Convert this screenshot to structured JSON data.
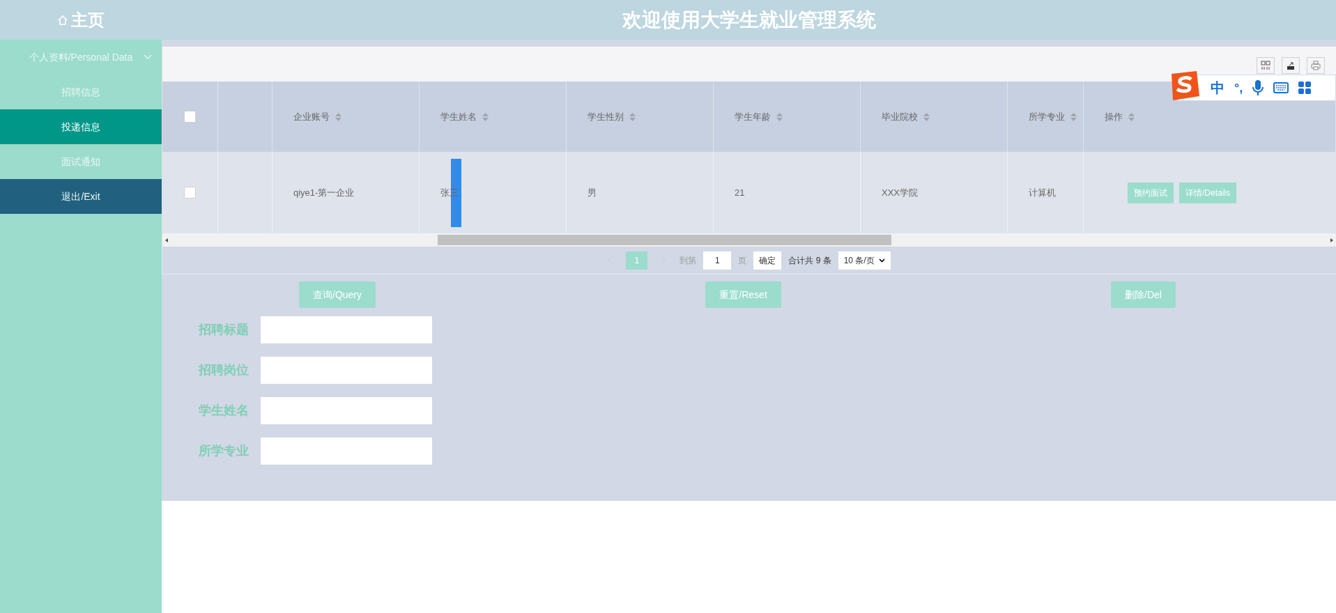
{
  "header": {
    "home": "主页",
    "title": "欢迎使用大学生就业管理系统"
  },
  "sidebar": {
    "items": [
      {
        "label": "个人资料/Personal Data",
        "kind": "group",
        "expanded": true,
        "selected": false
      },
      {
        "label": "招聘信息",
        "kind": "link",
        "selected": false
      },
      {
        "label": "投递信息",
        "kind": "link",
        "selected": true
      },
      {
        "label": "面试通知",
        "kind": "link",
        "selected": false
      },
      {
        "label": "退出/Exit",
        "kind": "exit",
        "selected": false
      }
    ]
  },
  "table": {
    "select_all": {
      "checked": false
    },
    "columns": [
      "企业账号",
      "学生姓名",
      "学生性别",
      "学生年龄",
      "毕业院校",
      "所学专业",
      "操作"
    ],
    "rows": [
      {
        "checked": false,
        "cells": [
          "qiye1-第一企业",
          "张三",
          "男",
          "21",
          "XXX学院",
          "计算机"
        ],
        "actions": [
          "预约面试",
          "详情/Details"
        ]
      }
    ]
  },
  "pagination": {
    "current": "1",
    "goto_label": "到第",
    "goto_value": "1",
    "page_unit": "页",
    "confirm": "确定",
    "total": "合计共 9 条",
    "page_size": "10 条/页"
  },
  "buttons": [
    "查询/Query",
    "重置/Reset",
    "删除/Del"
  ],
  "search_fields": [
    {
      "label": "招聘标题"
    },
    {
      "label": "招聘岗位"
    },
    {
      "label": "学生姓名"
    },
    {
      "label": "所学专业"
    }
  ],
  "ime_bar": {
    "mode": "中",
    "punctuation": "°,"
  }
}
